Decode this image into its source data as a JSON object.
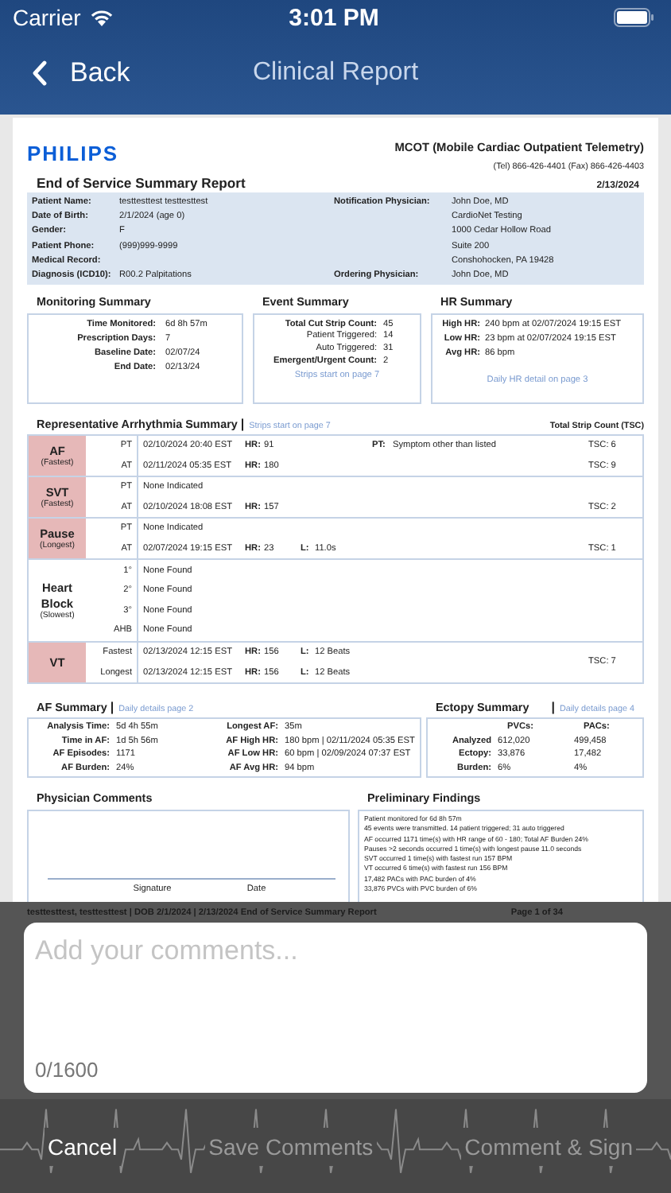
{
  "status_bar": {
    "carrier": "Carrier",
    "time": "3:01 PM"
  },
  "nav": {
    "back": "Back",
    "title": "Clinical Report"
  },
  "report": {
    "logo": "PHILIPS",
    "service": "MCOT (Mobile Cardiac Outpatient Telemetry)",
    "contact": "(Tel) 866-426-4401 (Fax) 866-426-4403",
    "title": "End of Service Summary Report",
    "date": "2/13/2024",
    "patient_left": [
      {
        "label": "Patient Name:",
        "value": "testtesttest testtesttest"
      },
      {
        "label": "Date of Birth:",
        "value": "2/1/2024 (age 0)"
      },
      {
        "label": "Gender:",
        "value": "F"
      },
      {
        "label": "Patient Phone:",
        "value": "(999)999-9999"
      },
      {
        "label": "Medical Record:"
      },
      {
        "label": "Diagnosis (ICD10):",
        "value": "R00.2 Palpitations"
      }
    ],
    "patient_right": [
      {
        "label": "Notification Physician:",
        "value": "John Doe, MD"
      },
      {
        "value": "CardioNet Testing"
      },
      {
        "value": "1000 Cedar Hollow Road"
      },
      {
        "value": "Suite 200"
      },
      {
        "value": "Conshohocken, PA 19428"
      },
      {
        "label": "Ordering Physician:",
        "value": "John Doe, MD"
      }
    ],
    "monitoring": {
      "title": "Monitoring Summary",
      "items": [
        {
          "label": "Time Monitored:",
          "value": "6d 8h 57m"
        },
        {
          "label": "Prescription Days:",
          "value": "7"
        },
        {
          "label": "Baseline Date:",
          "value": "02/07/24"
        },
        {
          "label": "End Date:",
          "value": "02/13/24"
        }
      ]
    },
    "event": {
      "title": "Event Summary",
      "link": "Strips start on page 7",
      "items": [
        {
          "label": "Total Cut Strip Count:",
          "value": "45",
          "emphasis": true
        },
        {
          "label": "Patient Triggered:",
          "value": "14",
          "emphasis": false
        },
        {
          "label": "Auto Triggered:",
          "value": "31",
          "emphasis": false
        },
        {
          "label": "Emergent/Urgent Count:",
          "value": "2",
          "emphasis": true
        }
      ]
    },
    "hr": {
      "title": "HR Summary",
      "link": "Daily HR detail on page 3",
      "items": [
        {
          "label": "High HR:",
          "value": "240 bpm at 02/07/2024 19:15 EST"
        },
        {
          "label": "Low HR:",
          "value": "23 bpm at 02/07/2024 19:15 EST"
        },
        {
          "label": "Avg HR:",
          "value": "86 bpm"
        }
      ]
    },
    "arrhythmia": {
      "title": "Representative Arrhythmia Summary",
      "separator": "|",
      "link": "Strips start on page  7",
      "tsc_heading": "Total Strip Count (TSC)",
      "groups": [
        {
          "name": "AF",
          "note": "(Fastest)",
          "highlighted": true,
          "rows": [
            {
              "tag": "PT",
              "text": "02/10/2024 20:40 EST",
              "hr_label": "HR:",
              "hr": "91",
              "symptom_label": "PT:",
              "symptom": "Symptom other than listed",
              "tsc": "TSC: 6"
            },
            {
              "tag": "AT",
              "text": "02/11/2024 05:35 EST",
              "hr_label": "HR:",
              "hr": "180",
              "tsc": "TSC: 9"
            }
          ]
        },
        {
          "name": "SVT",
          "note": "(Fastest)",
          "highlighted": true,
          "rows": [
            {
              "tag": "PT",
              "text": "None Indicated"
            },
            {
              "tag": "AT",
              "text": "02/10/2024 18:08 EST",
              "hr_label": "HR:",
              "hr": "157",
              "tsc": "TSC: 2"
            }
          ]
        },
        {
          "name": "Pause",
          "note": "(Longest)",
          "highlighted": true,
          "rows": [
            {
              "tag": "PT",
              "text": "None Indicated"
            },
            {
              "tag": "AT",
              "text": "02/07/2024 19:15 EST",
              "hr_label": "HR:",
              "hr": "23",
              "length_label": "L:",
              "length": "11.0s",
              "tsc": "TSC: 1"
            }
          ]
        },
        {
          "name": "Heart Block",
          "note": "(Slowest)",
          "highlighted": false,
          "rows": [
            {
              "tag": "1°",
              "text": "None Found"
            },
            {
              "tag": "2°",
              "text": "None Found"
            },
            {
              "tag": "3°",
              "text": "None Found"
            },
            {
              "tag": "AHB",
              "text": "None Found"
            }
          ]
        },
        {
          "name": "VT",
          "highlighted": true,
          "tsc": "TSC: 7",
          "rows": [
            {
              "tag": "Fastest",
              "text": "02/13/2024 12:15 EST",
              "hr_label": "HR:",
              "hr": "156",
              "length_label": "L:",
              "length": "12 Beats"
            },
            {
              "tag": "Longest",
              "text": "02/13/2024 12:15 EST",
              "hr_label": "HR:",
              "hr": "156",
              "length_label": "L:",
              "length": "12 Beats"
            }
          ]
        }
      ]
    },
    "af": {
      "title": "AF Summary",
      "separator": "|",
      "link": "Daily details page 2",
      "left": [
        {
          "label": "Analysis Time:",
          "value": "5d 4h 55m"
        },
        {
          "label": "Time in AF:",
          "value": "1d 5h 56m"
        },
        {
          "label": "AF Episodes:",
          "value": "1171"
        },
        {
          "label": "AF Burden:",
          "value": "24%"
        }
      ],
      "right": [
        {
          "label": "Longest AF:",
          "value": "35m"
        },
        {
          "label": "AF High HR:",
          "value": "180 bpm | 02/11/2024 05:35 EST"
        },
        {
          "label": "AF Low HR:",
          "value": "60 bpm | 02/09/2024 07:37 EST"
        },
        {
          "label": "AF Avg HR:",
          "value": "94 bpm"
        }
      ]
    },
    "ectopy": {
      "title": "Ectopy Summary",
      "separator": "|",
      "link": "Daily details page 4",
      "columns": [
        "PVCs:",
        "PACs:"
      ],
      "rows": [
        {
          "label": "Analyzed",
          "values": [
            "612,020",
            "499,458"
          ]
        },
        {
          "label": "Ectopy:",
          "values": [
            "33,876",
            "17,482"
          ]
        },
        {
          "label": "Burden:",
          "values": [
            "6%",
            "4%"
          ]
        }
      ]
    },
    "physician": {
      "title": "Physician Comments",
      "signature": "Signature",
      "date": "Date"
    },
    "findings": {
      "title": "Preliminary Findings",
      "lines": [
        "Patient monitored for 6d 8h 57m",
        "45 events were transmitted.  14 patient triggered; 31 auto triggered",
        "AF occurred 1171 time(s) with HR range of 60 - 180; Total AF Burden 24%",
        "Pauses >2 seconds occurred 1 time(s) with longest pause 11.0 seconds",
        "SVT occurred 1 time(s) with fastest run 157 BPM",
        "VT occurred 6 time(s) with fastest run 156 BPM",
        "17,482 PACs with PAC burden of 4%",
        "33,876 PVCs with PVC burden of 6%"
      ]
    },
    "footer": {
      "text": "testtesttest, testtesttest | DOB 2/1/2024 | 2/13/2024 End of Service Summary Report",
      "page": "Page 1 of  34"
    }
  },
  "comment": {
    "placeholder": "Add your comments...",
    "counter": "0/1600"
  },
  "actions": [
    {
      "label": "Cancel",
      "disabled": false
    },
    {
      "label": "Save Comments",
      "disabled": true
    },
    {
      "label": "Comment & Sign",
      "disabled": true
    }
  ]
}
